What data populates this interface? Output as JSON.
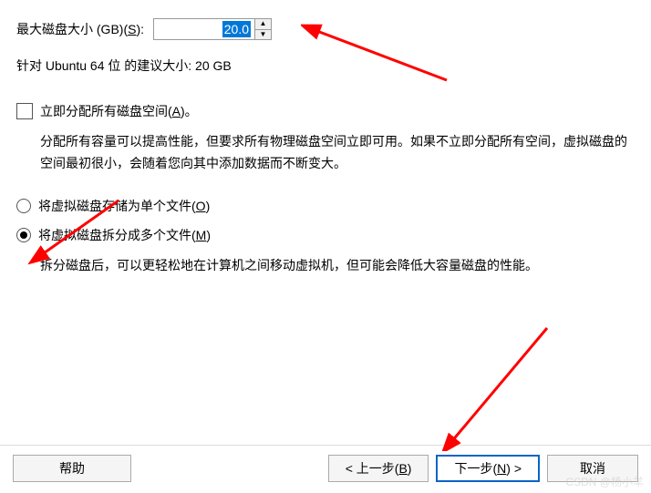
{
  "disk_size": {
    "label_prefix": "最大磁盘大小 (GB)(",
    "label_key": "S",
    "label_suffix": "):",
    "value": "20.0"
  },
  "recommend_text": "针对 Ubuntu 64 位 的建议大小: 20 GB",
  "allocate_now": {
    "label_prefix": "立即分配所有磁盘空间(",
    "label_key": "A",
    "label_suffix": ")。",
    "desc": "分配所有容量可以提高性能，但要求所有物理磁盘空间立即可用。如果不立即分配所有空间，虚拟磁盘的空间最初很小，会随着您向其中添加数据而不断变大。"
  },
  "radio_single": {
    "label_prefix": "将虚拟磁盘存储为单个文件(",
    "label_key": "O",
    "label_suffix": ")"
  },
  "radio_split": {
    "label_prefix": "将虚拟磁盘拆分成多个文件(",
    "label_key": "M",
    "label_suffix": ")",
    "desc": "拆分磁盘后，可以更轻松地在计算机之间移动虚拟机，但可能会降低大容量磁盘的性能。"
  },
  "buttons": {
    "help": "帮助",
    "back_prefix": "< 上一步(",
    "back_key": "B",
    "back_suffix": ")",
    "next_prefix": "下一步(",
    "next_key": "N",
    "next_suffix": ") >",
    "cancel": "取消"
  },
  "watermark": "CSDN @杨小羊"
}
